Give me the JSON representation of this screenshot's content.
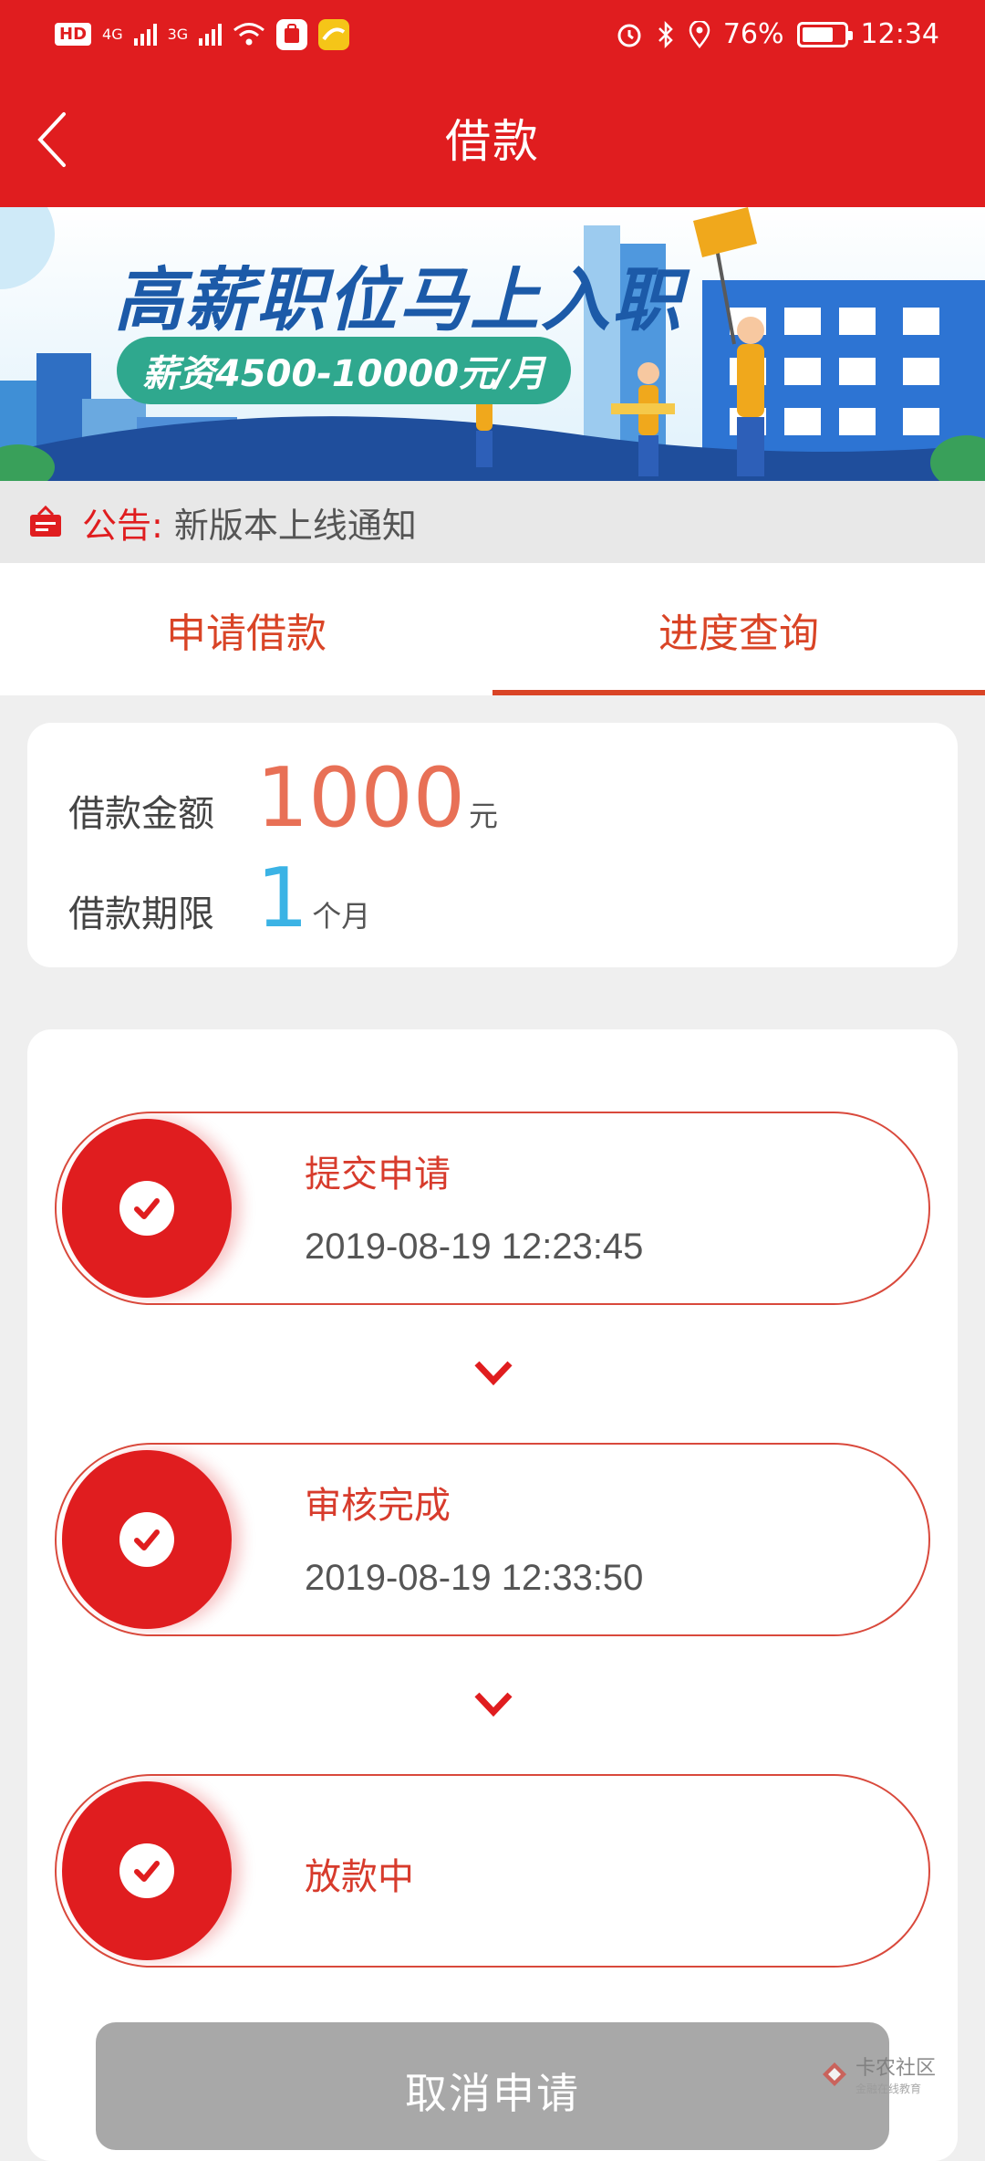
{
  "status_bar": {
    "hd": "HD",
    "net1": "4G",
    "net2": "3G",
    "battery_percent": "76%",
    "time": "12:34"
  },
  "nav": {
    "title": "借款"
  },
  "banner": {
    "headline": "高薪职位马上入职",
    "salary": "薪资4500-10000元/月"
  },
  "notice": {
    "label": "公告:",
    "text": "新版本上线通知"
  },
  "tabs": [
    {
      "label": "申请借款",
      "active": false
    },
    {
      "label": "进度查询",
      "active": true
    }
  ],
  "loan": {
    "amount_label": "借款金额",
    "amount_value": "1000",
    "amount_unit": "元",
    "term_label": "借款期限",
    "term_value": "1",
    "term_unit": "个月"
  },
  "steps": [
    {
      "title": "提交申请",
      "time": "2019-08-19 12:23:45"
    },
    {
      "title": "审核完成",
      "time": "2019-08-19 12:33:50"
    },
    {
      "title": "放款中",
      "time": ""
    }
  ],
  "cancel_button": "取消申请",
  "watermark": {
    "name": "卡农社区",
    "sub": "金融在线教育"
  },
  "colors": {
    "primary_red": "#e01d1f",
    "amount_orange": "#e87056",
    "term_blue": "#3bb3e5",
    "disabled_gray": "#a8a8a8"
  }
}
